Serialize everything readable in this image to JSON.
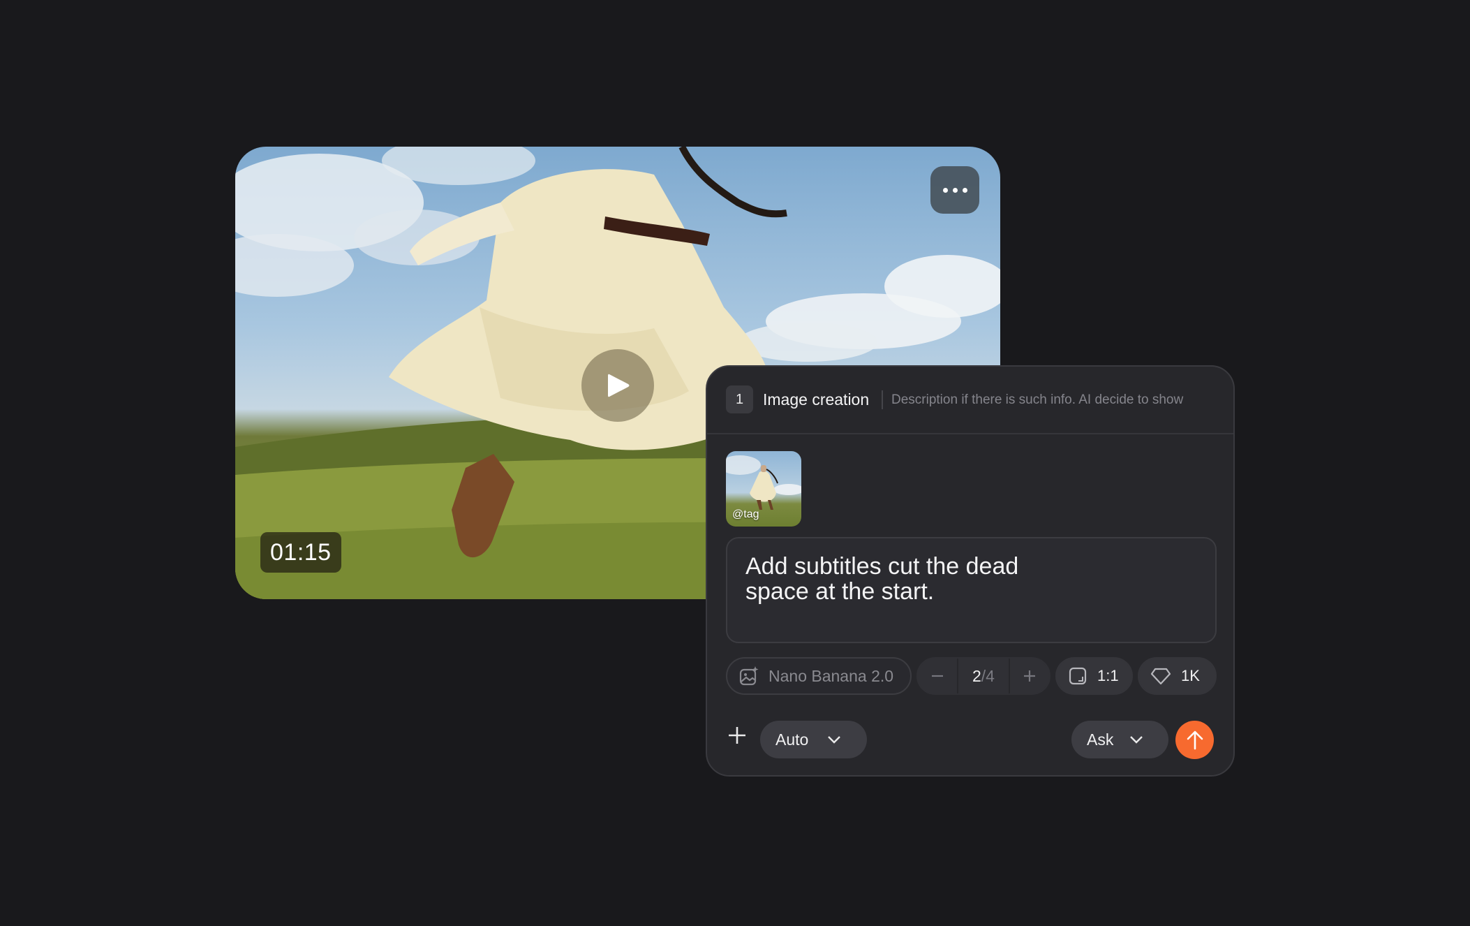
{
  "video": {
    "timecode": "01:15",
    "more_icon": "ellipsis-icon",
    "play_icon": "play-icon"
  },
  "panel": {
    "step_number": "1",
    "title": "Image creation",
    "description": "Description if there is such info. AI decide to show",
    "attachment": {
      "tag": "@tag"
    },
    "prompt_text": "Add subtitles cut the dead space at the start.",
    "options": {
      "model": {
        "icon": "image-sparkle-icon",
        "label": "Nano Banana 2.0"
      },
      "count": {
        "current": "2",
        "total": "/4",
        "decrement_icon": "minus-icon",
        "increment_icon": "plus-icon"
      },
      "aspect_ratio": {
        "icon": "aspect-ratio-icon",
        "value": "1:1"
      },
      "resolution": {
        "icon": "diamond-icon",
        "value": "1K"
      }
    },
    "footer": {
      "add_icon": "plus-icon",
      "mode": "Auto",
      "action": "Ask",
      "send_icon": "arrow-up-icon",
      "send_color": "#f76a2f"
    }
  }
}
